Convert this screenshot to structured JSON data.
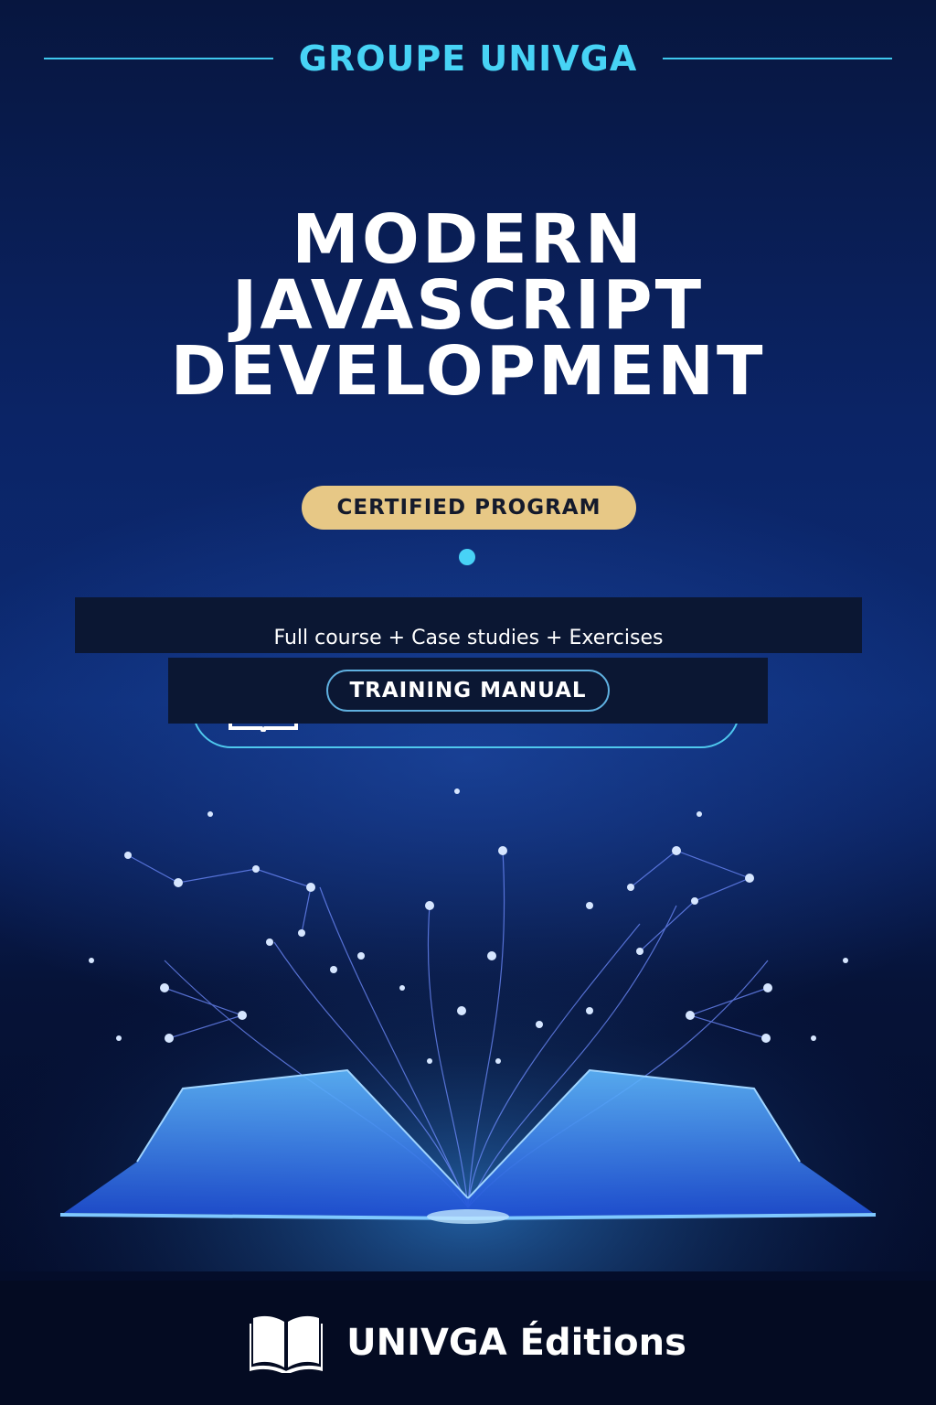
{
  "brand": {
    "name": "GROUPE UNIVGA"
  },
  "title": {
    "lines": [
      "MODERN",
      "JAVASCRIPT",
      "DEVELOPMENT"
    ]
  },
  "badge": {
    "label": "CERTIFIED PROGRAM"
  },
  "subtitle": {
    "text": "Full course + Case studies + Exercises"
  },
  "manual": {
    "label": "TRAINING MANUAL"
  },
  "footer": {
    "publisher": "UNIVGA Éditions",
    "icon": "open-book-icon"
  },
  "colors": {
    "accent": "#47d3f5",
    "badge": "#e7c886",
    "background": "#0b2466",
    "band": "#0b1733"
  }
}
